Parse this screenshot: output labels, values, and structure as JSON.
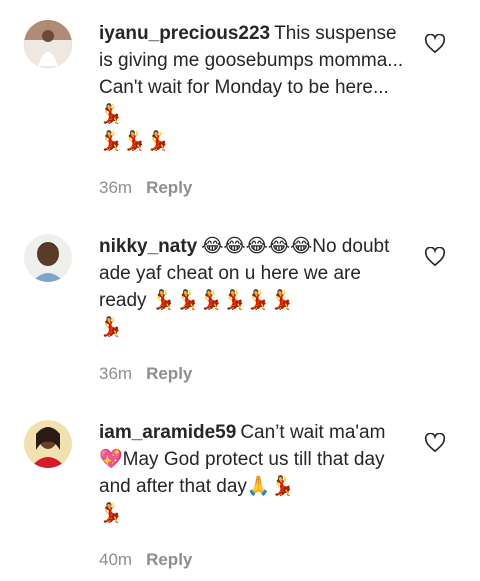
{
  "comments": [
    {
      "username": "iyanu_precious223",
      "text": "This suspense is giving me goosebumps momma... Can't wait for Monday to be here... 💃\n💃💃💃",
      "time": "36m",
      "reply_label": "Reply",
      "like_icon": "heart-outline-icon"
    },
    {
      "username": "nikky_naty",
      "text": "😂😂😂😂😂No doubt ade yaf cheat on u here we are ready 💃💃💃💃💃💃\n💃",
      "time": "36m",
      "reply_label": "Reply",
      "like_icon": "heart-outline-icon"
    },
    {
      "username": "iam_aramide59",
      "text": "Can’t wait ma'am💖May God protect us till that day and after that day🙏💃\n💃",
      "time": "40m",
      "reply_label": "Reply",
      "like_icon": "heart-outline-icon"
    }
  ]
}
